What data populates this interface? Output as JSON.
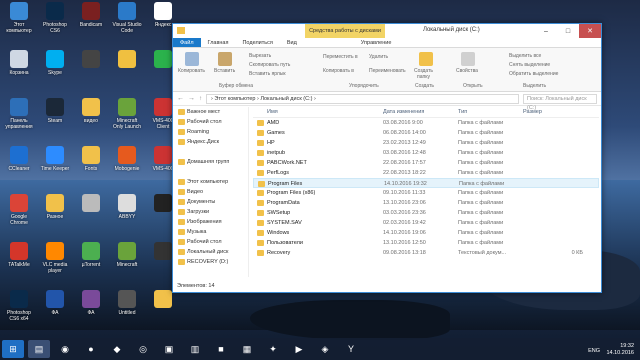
{
  "desktop": {
    "icons": [
      {
        "label": "Этот\nкомпьютер",
        "color": "#3a8ad6",
        "x": 0,
        "y": 0
      },
      {
        "label": "Photoshop\nCS6",
        "color": "#0a2a4a",
        "x": 1,
        "y": 0
      },
      {
        "label": "Bandicam",
        "color": "#7a2020",
        "x": 2,
        "y": 0
      },
      {
        "label": "Visual Studio\nCode",
        "color": "#2b7ac9",
        "x": 3,
        "y": 0
      },
      {
        "label": "Яндекс",
        "color": "#ffffff",
        "x": 4,
        "y": 0
      },
      {
        "label": "Корзина",
        "color": "#cfd8e3",
        "x": 0,
        "y": 1
      },
      {
        "label": "Skype",
        "color": "#00aff0",
        "x": 1,
        "y": 1
      },
      {
        "label": "",
        "color": "#444",
        "x": 2,
        "y": 1
      },
      {
        "label": "",
        "color": "#f0c040",
        "x": 3,
        "y": 1
      },
      {
        "label": "",
        "color": "#2bb24c",
        "x": 4,
        "y": 1
      },
      {
        "label": "Панель\nуправления",
        "color": "#2d6fb8",
        "x": 0,
        "y": 2
      },
      {
        "label": "Steam",
        "color": "#1b2838",
        "x": 1,
        "y": 2
      },
      {
        "label": "видео",
        "color": "#f1c14a",
        "x": 2,
        "y": 2
      },
      {
        "label": "Minecraft\nOnly Launch",
        "color": "#6aa33b",
        "x": 3,
        "y": 2
      },
      {
        "label": "VMS-400\nClient",
        "color": "#cc3333",
        "x": 4,
        "y": 2
      },
      {
        "label": "CCleaner",
        "color": "#1d6fd1",
        "x": 0,
        "y": 3
      },
      {
        "label": "Time Keeper",
        "color": "#2d8cff",
        "x": 1,
        "y": 3
      },
      {
        "label": "Fonts",
        "color": "#f1c14a",
        "x": 2,
        "y": 3
      },
      {
        "label": "Mobogenie",
        "color": "#e65a1e",
        "x": 3,
        "y": 3
      },
      {
        "label": "VMS-400",
        "color": "#cc3333",
        "x": 4,
        "y": 3
      },
      {
        "label": "Google\nChrome",
        "color": "#db4437",
        "x": 0,
        "y": 4
      },
      {
        "label": "Разное",
        "color": "#f1c14a",
        "x": 1,
        "y": 4
      },
      {
        "label": "",
        "color": "#bbb",
        "x": 2,
        "y": 4
      },
      {
        "label": "ABBYY",
        "color": "#dddddd",
        "x": 3,
        "y": 4
      },
      {
        "label": "",
        "color": "#222",
        "x": 4,
        "y": 4
      },
      {
        "label": "TATalkMe",
        "color": "#d4362a",
        "x": 0,
        "y": 5
      },
      {
        "label": "VLC media\nplayer",
        "color": "#ff8800",
        "x": 1,
        "y": 5
      },
      {
        "label": "µTorrent",
        "color": "#4caf50",
        "x": 2,
        "y": 5
      },
      {
        "label": "Minecraft",
        "color": "#6aa33b",
        "x": 3,
        "y": 5
      },
      {
        "label": "",
        "color": "#333",
        "x": 4,
        "y": 5
      },
      {
        "label": "Photoshop\nCS6 x64",
        "color": "#0a2a4a",
        "x": 0,
        "y": 6
      },
      {
        "label": "ФА",
        "color": "#2255aa",
        "x": 1,
        "y": 6
      },
      {
        "label": "ФА",
        "color": "#7a4a9a",
        "x": 2,
        "y": 6
      },
      {
        "label": "Untitled",
        "color": "#555",
        "x": 3,
        "y": 6
      },
      {
        "label": "",
        "color": "#f1c14a",
        "x": 4,
        "y": 6
      }
    ]
  },
  "window": {
    "context_tab": "Средства работы с дисками",
    "title": "Локальный диск (C:)",
    "tabs": [
      "Файл",
      "Главная",
      "Поделиться",
      "Вид",
      "Управление"
    ],
    "ribbon": {
      "copy": "Копировать",
      "paste": "Вставить",
      "cut": "Вырезать",
      "copy_path": "Скопировать путь",
      "paste_shortcut": "Вставить ярлык",
      "group_clipboard": "Буфер обмена",
      "move_to": "Переместить в",
      "copy_to": "Копировать в",
      "delete": "Удалить",
      "rename": "Переименовать",
      "group_organize": "Упорядочить",
      "new_folder": "Создать\nпапку",
      "group_create": "Создать",
      "properties": "Свойства",
      "group_open": "Открыть",
      "select_all": "Выделить все",
      "select_none": "Снять выделение",
      "invert": "Обратить выделение",
      "group_select": "Выделить"
    },
    "address": "›  Этот компьютер  ›  Локальный диск (C:)  ›",
    "search_placeholder": "Поиск: Локальный диск (C:)",
    "nav": [
      "Важное мест",
      "Рабочий стол",
      "Roaming",
      "Яндекс.Диск",
      "",
      "Домашняя групп",
      "",
      "Этот компьютер",
      "Видео",
      "Документы",
      "Загрузки",
      "Изображения",
      "Музыка",
      "Рабочий стол",
      "Локальный диск",
      "RECOVERY (D:)"
    ],
    "columns": [
      "Имя",
      "Дата изменения",
      "Тип",
      "Размер"
    ],
    "files": [
      {
        "name": "AMD",
        "date": "03.08.2016 9:00",
        "type": "Папка с файлами",
        "size": ""
      },
      {
        "name": "Games",
        "date": "06.08.2016 14:00",
        "type": "Папка с файлами",
        "size": ""
      },
      {
        "name": "HP",
        "date": "23.02.2013 12:49",
        "type": "Папка с файлами",
        "size": ""
      },
      {
        "name": "inetpub",
        "date": "03.08.2016 12:48",
        "type": "Папка с файлами",
        "size": ""
      },
      {
        "name": "PABCWork.NET",
        "date": "22.08.2016 17:57",
        "type": "Папка с файлами",
        "size": ""
      },
      {
        "name": "PerfLogs",
        "date": "22.08.2013 18:22",
        "type": "Папка с файлами",
        "size": ""
      },
      {
        "name": "Program Files",
        "date": "14.10.2016 19:32",
        "type": "Папка с файлами",
        "size": ""
      },
      {
        "name": "Program Files (x86)",
        "date": "09.10.2016 11:33",
        "type": "Папка с файлами",
        "size": ""
      },
      {
        "name": "ProgramData",
        "date": "13.10.2016 23:06",
        "type": "Папка с файлами",
        "size": ""
      },
      {
        "name": "SWSetup",
        "date": "03.03.2016 23:36",
        "type": "Папка с файлами",
        "size": ""
      },
      {
        "name": "SYSTEM.SAV",
        "date": "02.03.2016 19:42",
        "type": "Папка с файлами",
        "size": ""
      },
      {
        "name": "Windows",
        "date": "14.10.2016 19:06",
        "type": "Папка с файлами",
        "size": ""
      },
      {
        "name": "Пользователи",
        "date": "13.10.2016 12:50",
        "type": "Папка с файлами",
        "size": ""
      },
      {
        "name": "Recovery",
        "date": "09.08.2016 13:18",
        "type": "Текстовый докум...",
        "size": "0 КБ"
      }
    ],
    "selected_index": 6,
    "status": "Элементов: 14"
  },
  "taskbar": {
    "lang": "ENG",
    "time": "19:32",
    "date": "14.10.2016"
  }
}
